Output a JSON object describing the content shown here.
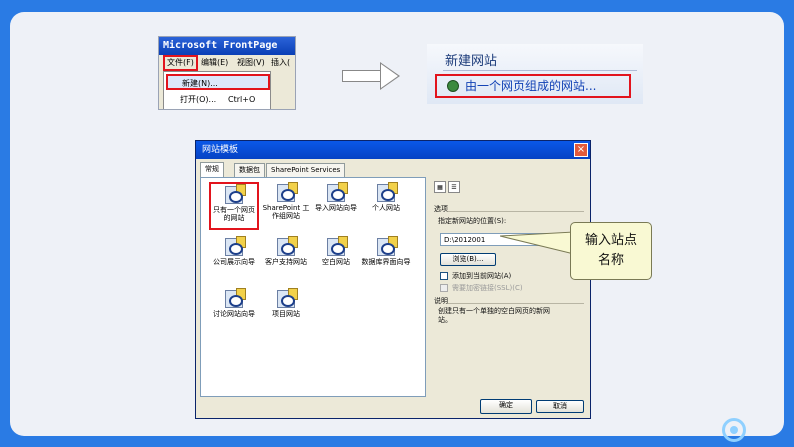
{
  "menu_screenshot": {
    "app_title": "Microsoft FrontPage",
    "menu_items": [
      "文件(F)",
      "编辑(E)",
      "视图(V)",
      "插入("
    ],
    "dropdown_items": [
      {
        "label": "新建(N)...",
        "shortcut": ""
      },
      {
        "label": "打开(O)...",
        "shortcut": "Ctrl+O"
      }
    ]
  },
  "new_site_panel": {
    "header": "新建网站",
    "link": "由一个网页组成的网站..."
  },
  "dialog": {
    "title": "网站模板",
    "close_glyph": "×",
    "tabs": [
      "常规",
      "数据包",
      "SharePoint Services"
    ],
    "templates": [
      "只有一个网页的网站",
      "SharePoint 工作组网站",
      "导入网站向导",
      "个人网站",
      "公司展示向导",
      "客户支持网站",
      "空白网站",
      "数据库界面向导",
      "讨论网站向导",
      "项目网站"
    ],
    "options_label": "选项",
    "location_label": "指定新网站的位置(S):",
    "location_value": "D:\\2012001",
    "browse_button": "浏览(B)...",
    "add_to_current": "添加到当前网站(A)",
    "require_ssl": "需要加密链接(SSL)(C)",
    "description_label": "说明",
    "description_text": "创建只有一个单独的空白网页的新网站。",
    "ok_button": "确定",
    "cancel_button": "取消"
  },
  "callout": {
    "line1": "输入站点",
    "line2": "名称"
  },
  "colors": {
    "background": "#2a7be4",
    "slide": "#eef1f7",
    "highlight": "#e2141d",
    "callout": "#f9f9d3"
  }
}
